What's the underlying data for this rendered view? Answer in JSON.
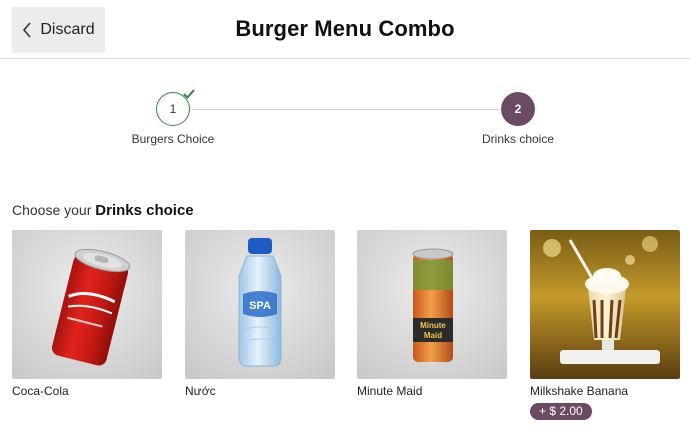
{
  "header": {
    "discard_label": "Discard",
    "title": "Burger Menu Combo"
  },
  "stepper": {
    "steps": [
      {
        "number": "1",
        "label": "Burgers Choice",
        "state": "done"
      },
      {
        "number": "2",
        "label": "Drinks choice",
        "state": "active"
      }
    ]
  },
  "section": {
    "prefix": "Choose your ",
    "emphasis": "Drinks choice"
  },
  "drinks": [
    {
      "name": "Coca-Cola"
    },
    {
      "name": "Nước"
    },
    {
      "name": "Minute Maid"
    },
    {
      "name": "Milkshake Banana",
      "price": "+ $ 2.00"
    }
  ],
  "colors": {
    "accent": "#6b4a64",
    "check": "#2e8b3e"
  }
}
